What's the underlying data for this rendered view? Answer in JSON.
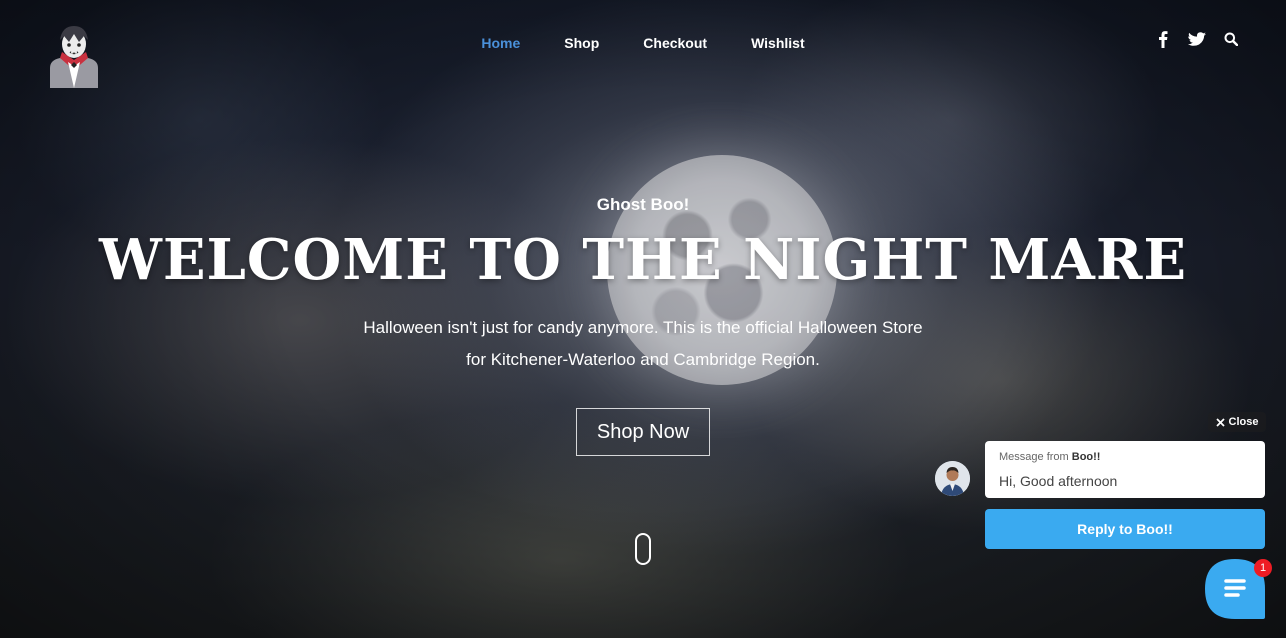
{
  "nav": {
    "items": [
      {
        "label": "Home",
        "active": true
      },
      {
        "label": "Shop"
      },
      {
        "label": "Checkout"
      },
      {
        "label": "Wishlist"
      }
    ]
  },
  "social": {
    "icons": [
      "facebook-icon",
      "twitter-icon",
      "search-icon"
    ]
  },
  "hero": {
    "eyebrow": "Ghost Boo!",
    "title": "WELCOME TO THE NIGHT MARE",
    "description_line1": "Halloween isn't just for candy anymore. This is the official Halloween Store",
    "description_line2": "for Kitchener-Waterloo and Cambridge Region.",
    "cta": "Shop Now"
  },
  "chat": {
    "close_label": "Close",
    "from_prefix": "Message from",
    "from_name": "Boo!!",
    "message": "Hi, Good afternoon",
    "reply_label": "Reply to Boo!!",
    "badge_count": "1"
  },
  "colors": {
    "nav_active": "#4a90d9",
    "reply_button": "#3aaaf0",
    "chat_bubble": "#3aaaf0",
    "badge": "#ee1c24"
  }
}
